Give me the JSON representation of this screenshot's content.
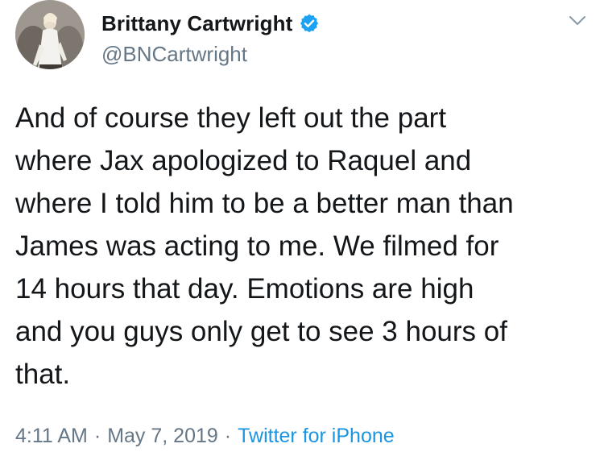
{
  "author": {
    "display_name": "Brittany Cartwright",
    "handle": "@BNCartwright",
    "verified": true,
    "verified_badge_color": "#1da1f2"
  },
  "tweet": {
    "text": "And of course they left out the part\nwhere Jax apologized to Raquel and\nwhere I told him to be a better man than\nJames was acting to me. We filmed for\n14 hours that day. Emotions are high\nand you guys only get to see 3 hours of\nthat."
  },
  "meta": {
    "time": "4:11 AM",
    "separator": "·",
    "date": "May 7, 2019",
    "source": "Twitter for iPhone"
  },
  "icons": {
    "avatar": "profile-photo",
    "verified": "verified-badge-icon",
    "menu": "chevron-down-icon"
  },
  "colors": {
    "text": "#14171a",
    "secondary": "#657786",
    "link": "#1b95e0"
  }
}
